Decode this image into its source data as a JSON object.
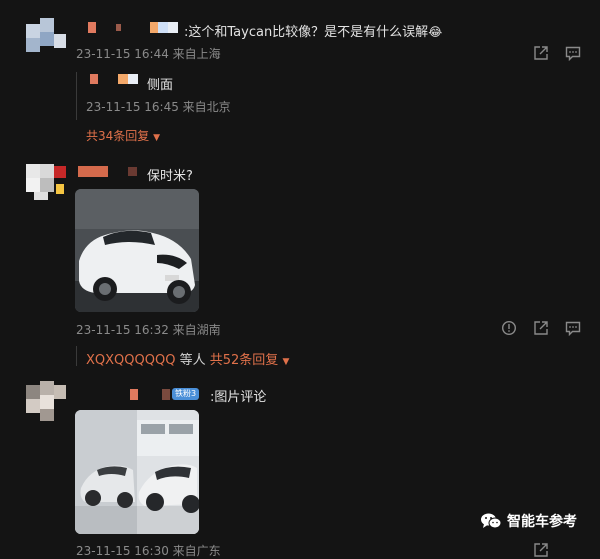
{
  "comments": [
    {
      "text": ":这个和Taycan比较像？是不是有什么误解",
      "emoji": "😂",
      "meta": "23-11-15 16:44 来自上海",
      "reply": {
        "text": "侧面",
        "meta": "23-11-15 16:45 来自北京"
      },
      "reply_count": "共34条回复"
    },
    {
      "text": "保时米?",
      "meta": "23-11-15 16:32 来自湖南",
      "replier": "XQXQQQQQQ",
      "replier_suffix": "等人",
      "reply_count": "共52条回复"
    },
    {
      "badge": "铁粉3",
      "text": ":图片评论",
      "meta": "23-11-15 16:30 来自广东"
    }
  ],
  "watermark": {
    "text": "智能车参考",
    "icon": "wechat-icon"
  },
  "icons": {
    "share": "share-icon",
    "comment": "comment-icon",
    "report": "report-icon",
    "dropdown": "caret-down-icon"
  },
  "colors": {
    "background": "#141414",
    "accent": "#e0714a",
    "meta": "#8a8a8a",
    "text": "#e3e3e3"
  }
}
